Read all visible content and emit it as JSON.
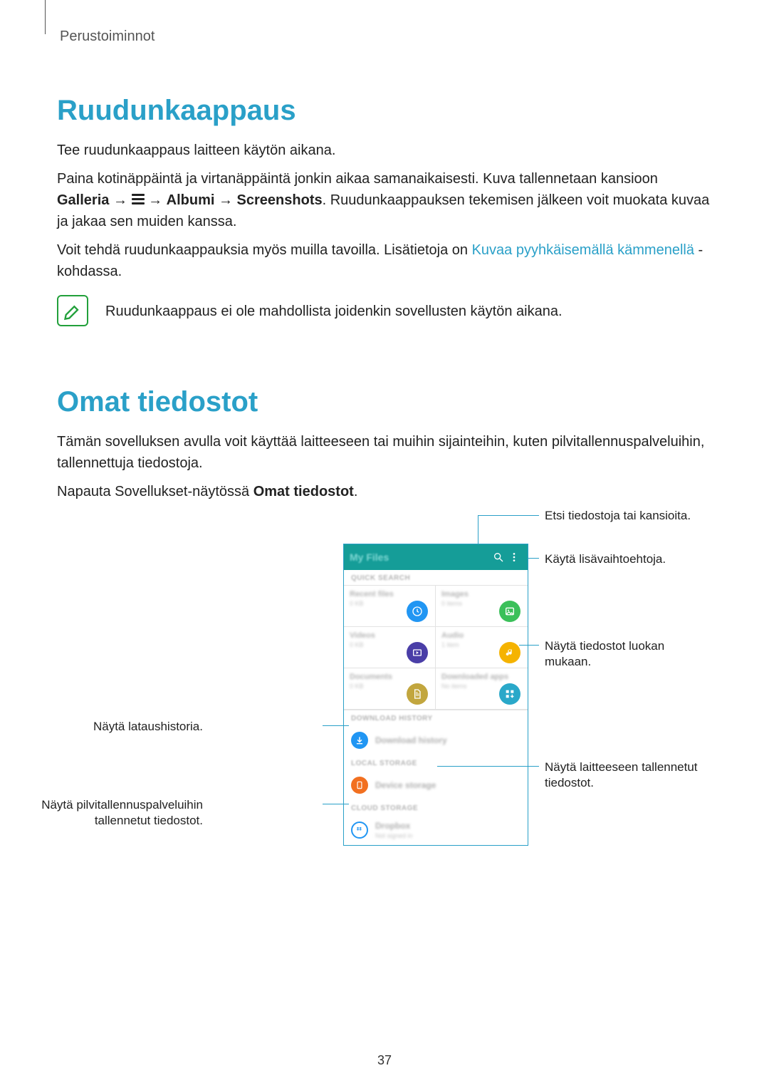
{
  "header": "Perustoiminnot",
  "section1": {
    "title": "Ruudunkaappaus",
    "p1": "Tee ruudunkaappaus laitteen käytön aikana.",
    "p2a": "Paina kotinäppäintä ja virtanäppäintä jonkin aikaa samanaikaisesti. Kuva tallennetaan kansioon ",
    "p2_galleria": "Galleria",
    "p2_albumi": "Albumi",
    "p2_screens": "Screenshots",
    "p2b": ". Ruudunkaappauksen tekemisen jälkeen voit muokata kuvaa ja jakaa sen muiden kanssa.",
    "p3a": "Voit tehdä ruudunkaappauksia myös muilla tavoilla. Lisätietoja on ",
    "p3_link": "Kuvaa pyyhkäisemällä kämmenellä",
    "p3b": " -kohdassa.",
    "note": "Ruudunkaappaus ei ole mahdollista joidenkin sovellusten käytön aikana."
  },
  "section2": {
    "title": "Omat tiedostot",
    "p1": "Tämän sovelluksen avulla voit käyttää laitteeseen tai muihin sijainteihin, kuten pilvitallennuspalveluihin, tallennettuja tiedostoja.",
    "p2a": "Napauta Sovellukset-näytössä ",
    "p2_bold": "Omat tiedostot",
    "p2b": "."
  },
  "callouts": {
    "search": "Etsi tiedostoja tai kansioita.",
    "more": "Käytä lisävaihtoehtoja.",
    "category": "Näytä tiedostot luokan mukaan.",
    "downloads": "Näytä lataushistoria.",
    "device": "Näytä laitteeseen tallennetut tiedostot.",
    "cloud": "Näytä pilvitallennuspalveluihin tallennetut tiedostot."
  },
  "phone": {
    "title": "My Files",
    "quick": "QUICK SEARCH",
    "cells": [
      {
        "t": "Recent files",
        "s": "0 KB"
      },
      {
        "t": "Images",
        "s": "0 items"
      },
      {
        "t": "Videos",
        "s": "0 KB"
      },
      {
        "t": "Audio",
        "s": "1 item"
      },
      {
        "t": "Documents",
        "s": "0 KB"
      },
      {
        "t": "Downloaded apps",
        "s": "No items"
      }
    ],
    "dl_header": "DOWNLOAD HISTORY",
    "dl_row": "Download history",
    "local_header": "LOCAL STORAGE",
    "local_row": "Device storage",
    "cloud_header": "CLOUD STORAGE",
    "cloud_row": "Dropbox",
    "cloud_sub": "Not signed in"
  },
  "arrow": "→",
  "pagenum": "37"
}
